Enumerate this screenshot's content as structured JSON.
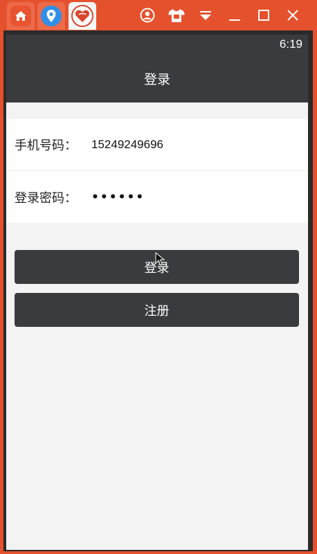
{
  "window": {
    "tabs": [
      {
        "name": "home-app",
        "icon": "home-icon"
      },
      {
        "name": "location-app",
        "icon": "map-pin-icon"
      },
      {
        "name": "heart-app",
        "icon": "heart-icon"
      }
    ],
    "controls": [
      "account-icon",
      "shirt-icon",
      "dropdown-icon",
      "minimize-icon",
      "maximize-icon",
      "close-icon"
    ]
  },
  "status": {
    "time": "6:19"
  },
  "actionbar": {
    "title": "登录"
  },
  "form": {
    "phone_label": "手机号码：",
    "phone_value": "15249249696",
    "password_label": "登录密码：",
    "password_masked": "••••••"
  },
  "buttons": {
    "login_label": "登录",
    "register_label": "注册"
  },
  "colors": {
    "window_frame": "#e4512c",
    "toolbar": "#3a3b3e",
    "background": "#f3f3f3",
    "button": "#3a3b3e"
  }
}
